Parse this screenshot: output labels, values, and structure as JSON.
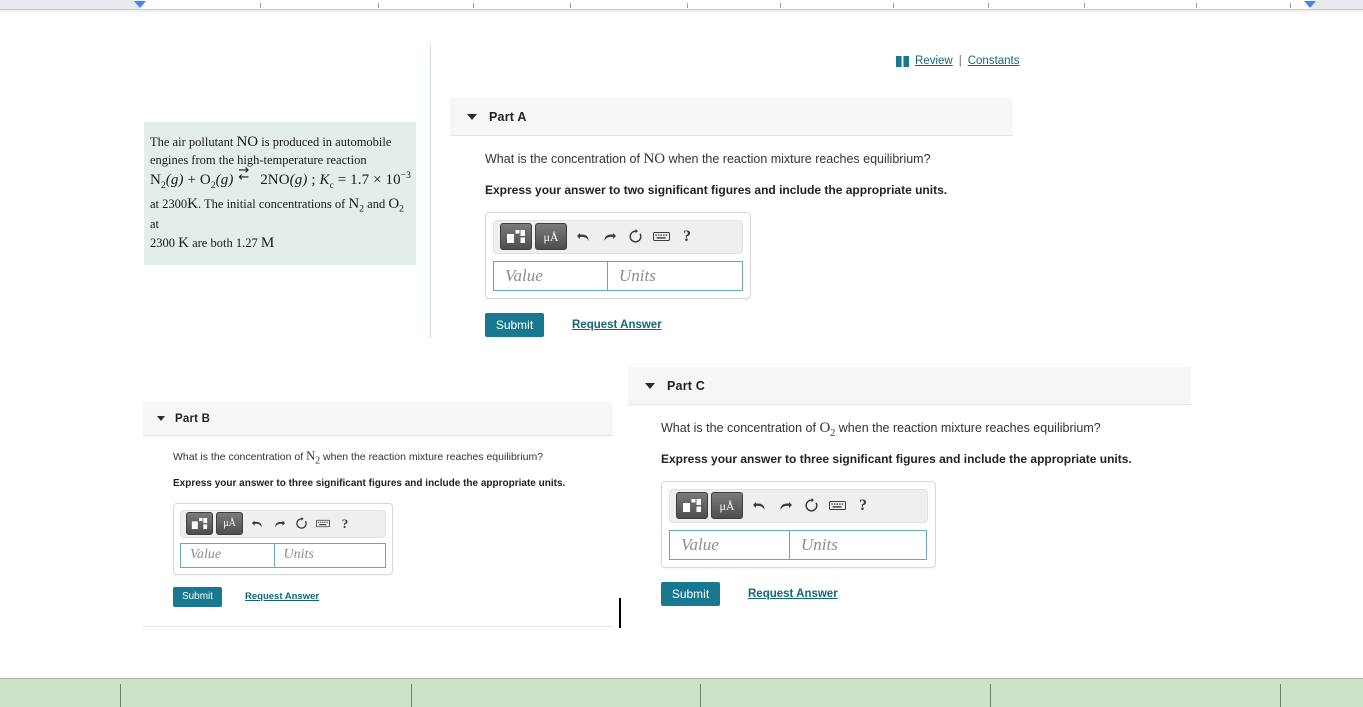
{
  "ruler": {
    "marker_left_label": "left-indent-marker",
    "marker_right_label": "right-indent-marker"
  },
  "review_bar": {
    "book_icon": "book-icon",
    "review_label": "Review",
    "separator": "|",
    "constants_label": "Constants"
  },
  "problem": {
    "line1": "The air pollutant",
    "chem_no": "NO",
    "line1b": "is produced in automobile",
    "line2": "engines from the high-temperature reaction",
    "eq_left": "N",
    "eq_left_sub": "2",
    "eq_left_state": "(g)",
    "eq_plus": "+",
    "eq_o2": "O",
    "eq_o2_sub": "2",
    "eq_o2_state": "(g)",
    "eq_arrow_forward": "→",
    "eq_arrow_reverse": "←",
    "eq_right_coeff": "2NO",
    "eq_right_state": "(g)",
    "eq_semicolon": ";",
    "eq_kc": "K",
    "eq_kc_sub": "c",
    "eq_equals": "=",
    "eq_kc_value": "1.7",
    "eq_times": "×",
    "eq_base": "10",
    "eq_exp": "−3",
    "line4a": "at 2300",
    "line4_unit": "K",
    "line4b": ". The initial concentrations of",
    "line4_n2": "N",
    "line4_n2_sub": "2",
    "line4_and": "and",
    "line4_o2": "O",
    "line4_o2_sub": "2",
    "line4_at": "at",
    "line5a": "2300",
    "line5_unit": "K",
    "line5b": "are both 1.27",
    "line5_m": "M"
  },
  "parts": [
    {
      "id": "A",
      "title": "Part A",
      "question_prefix": "What is the concentration of",
      "question_species": "NO",
      "question_species_sub": "",
      "question_suffix": "when the reaction mixture reaches equilibrium?",
      "instruction": "Express your answer to two significant figures and include the appropriate units.",
      "toolbar": {
        "template_button": "math-template-button",
        "units_button_label": "μÅ",
        "undo_icon": "undo-icon",
        "redo_icon": "redo-icon",
        "reset_icon": "reset-icon",
        "keyboard_icon": "keyboard-icon",
        "help_label": "?"
      },
      "value_placeholder": "Value",
      "units_placeholder": "Units",
      "value_current": "",
      "units_current": "",
      "submit_label": "Submit",
      "request_label": "Request Answer"
    },
    {
      "id": "B",
      "title": "Part B",
      "question_prefix": "What is the concentration of",
      "question_species": "N",
      "question_species_sub": "2",
      "question_suffix": "when the reaction mixture reaches equilibrium?",
      "instruction": "Express your answer to three significant figures and include the appropriate units.",
      "toolbar": {
        "template_button": "math-template-button",
        "units_button_label": "μÅ",
        "undo_icon": "undo-icon",
        "redo_icon": "redo-icon",
        "reset_icon": "reset-icon",
        "keyboard_icon": "keyboard-icon",
        "help_label": "?"
      },
      "value_placeholder": "Value",
      "units_placeholder": "Units",
      "value_current": "",
      "units_current": "",
      "submit_label": "Submit",
      "request_label": "Request Answer"
    },
    {
      "id": "C",
      "title": "Part C",
      "question_prefix": "What is the concentration of",
      "question_species": "O",
      "question_species_sub": "2",
      "question_suffix": "when the reaction mixture reaches equilibrium?",
      "instruction": "Express your answer to three significant figures and include the appropriate units.",
      "toolbar": {
        "template_button": "math-template-button",
        "units_button_label": "μÅ",
        "undo_icon": "undo-icon",
        "redo_icon": "redo-icon",
        "reset_icon": "reset-icon",
        "keyboard_icon": "keyboard-icon",
        "help_label": "?"
      },
      "value_placeholder": "Value",
      "units_placeholder": "Units",
      "value_current": "",
      "units_current": "",
      "submit_label": "Submit",
      "request_label": "Request Answer"
    }
  ],
  "colors": {
    "accent_teal": "#17788f",
    "link_teal": "#13667a",
    "problem_box_bg": "#e3eeec",
    "part_header_bg": "#f6f6f6",
    "bottom_bar_bg": "#cde3c8",
    "field_border": "#6aa8b5"
  }
}
